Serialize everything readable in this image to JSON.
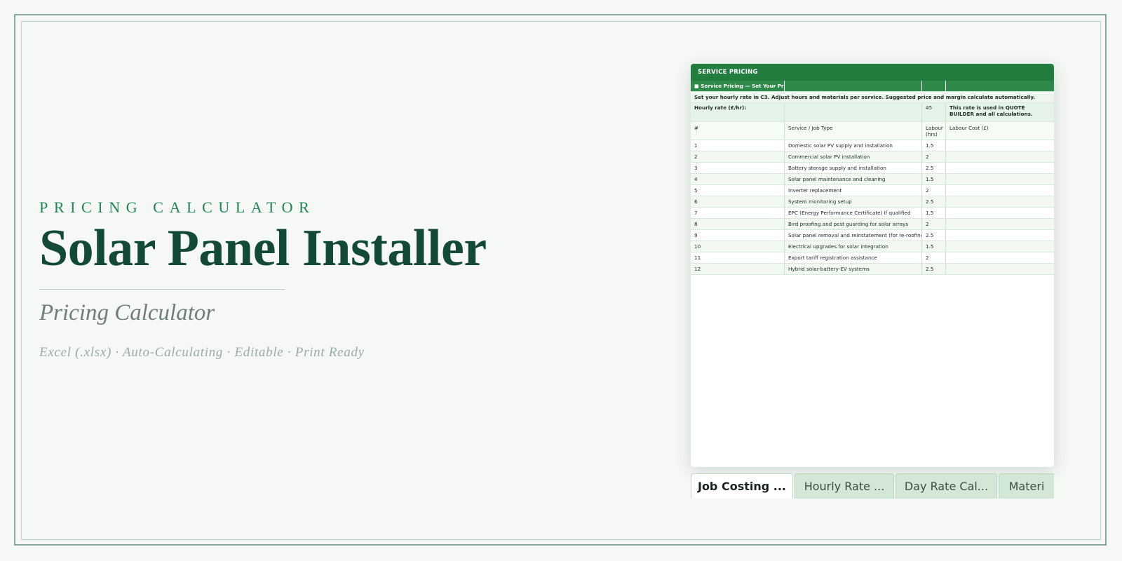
{
  "hero": {
    "eyebrow": "PRICING CALCULATOR",
    "title": "Solar Panel Installer",
    "subtitle": "Pricing Calculator",
    "features": "Excel (.xlsx) · Auto-Calculating · Editable · Print Ready"
  },
  "sheet": {
    "header": "SERVICE PRICING",
    "section": {
      "a": "■ Service Pricing — Set Your Prices"
    },
    "note": "Set your hourly rate in C3. Adjust hours and materials per service. Suggested price and margin calculate automatically.",
    "rate": {
      "label": "Hourly rate (£/hr):",
      "value": "45",
      "note": "This rate is used in QUOTE BUILDER and all calculations."
    },
    "columns": {
      "num": "#",
      "service": "Service / Job Type",
      "hours": "Labour (hrs)",
      "cost": "Labour Cost (£)"
    },
    "rows": [
      {
        "num": "1",
        "service": "Domestic solar PV supply and installation",
        "hours": "1.5"
      },
      {
        "num": "2",
        "service": "Commercial solar PV installation",
        "hours": "2"
      },
      {
        "num": "3",
        "service": "Battery storage supply and installation",
        "hours": "2.5"
      },
      {
        "num": "4",
        "service": "Solar panel maintenance and cleaning",
        "hours": "1.5"
      },
      {
        "num": "5",
        "service": "Inverter replacement",
        "hours": "2"
      },
      {
        "num": "6",
        "service": "System monitoring setup",
        "hours": "2.5"
      },
      {
        "num": "7",
        "service": "EPC (Energy Performance Certificate) if qualified",
        "hours": "1.5"
      },
      {
        "num": "8",
        "service": "Bird proofing and pest guarding for solar arrays",
        "hours": "2"
      },
      {
        "num": "9",
        "service": "Solar panel removal and reinstatement (for re-roofing)",
        "hours": "2.5"
      },
      {
        "num": "10",
        "service": "Electrical upgrades for solar integration",
        "hours": "1.5"
      },
      {
        "num": "11",
        "service": "Export tariff registration assistance",
        "hours": "2"
      },
      {
        "num": "12",
        "service": "Hybrid solar-battery-EV systems",
        "hours": "2.5"
      }
    ]
  },
  "tabs": [
    {
      "label": "Job Costing ...",
      "active": true
    },
    {
      "label": "Hourly Rate ...",
      "active": false
    },
    {
      "label": "Day Rate Cal...",
      "active": false
    },
    {
      "label": "Materi",
      "active": false
    }
  ]
}
